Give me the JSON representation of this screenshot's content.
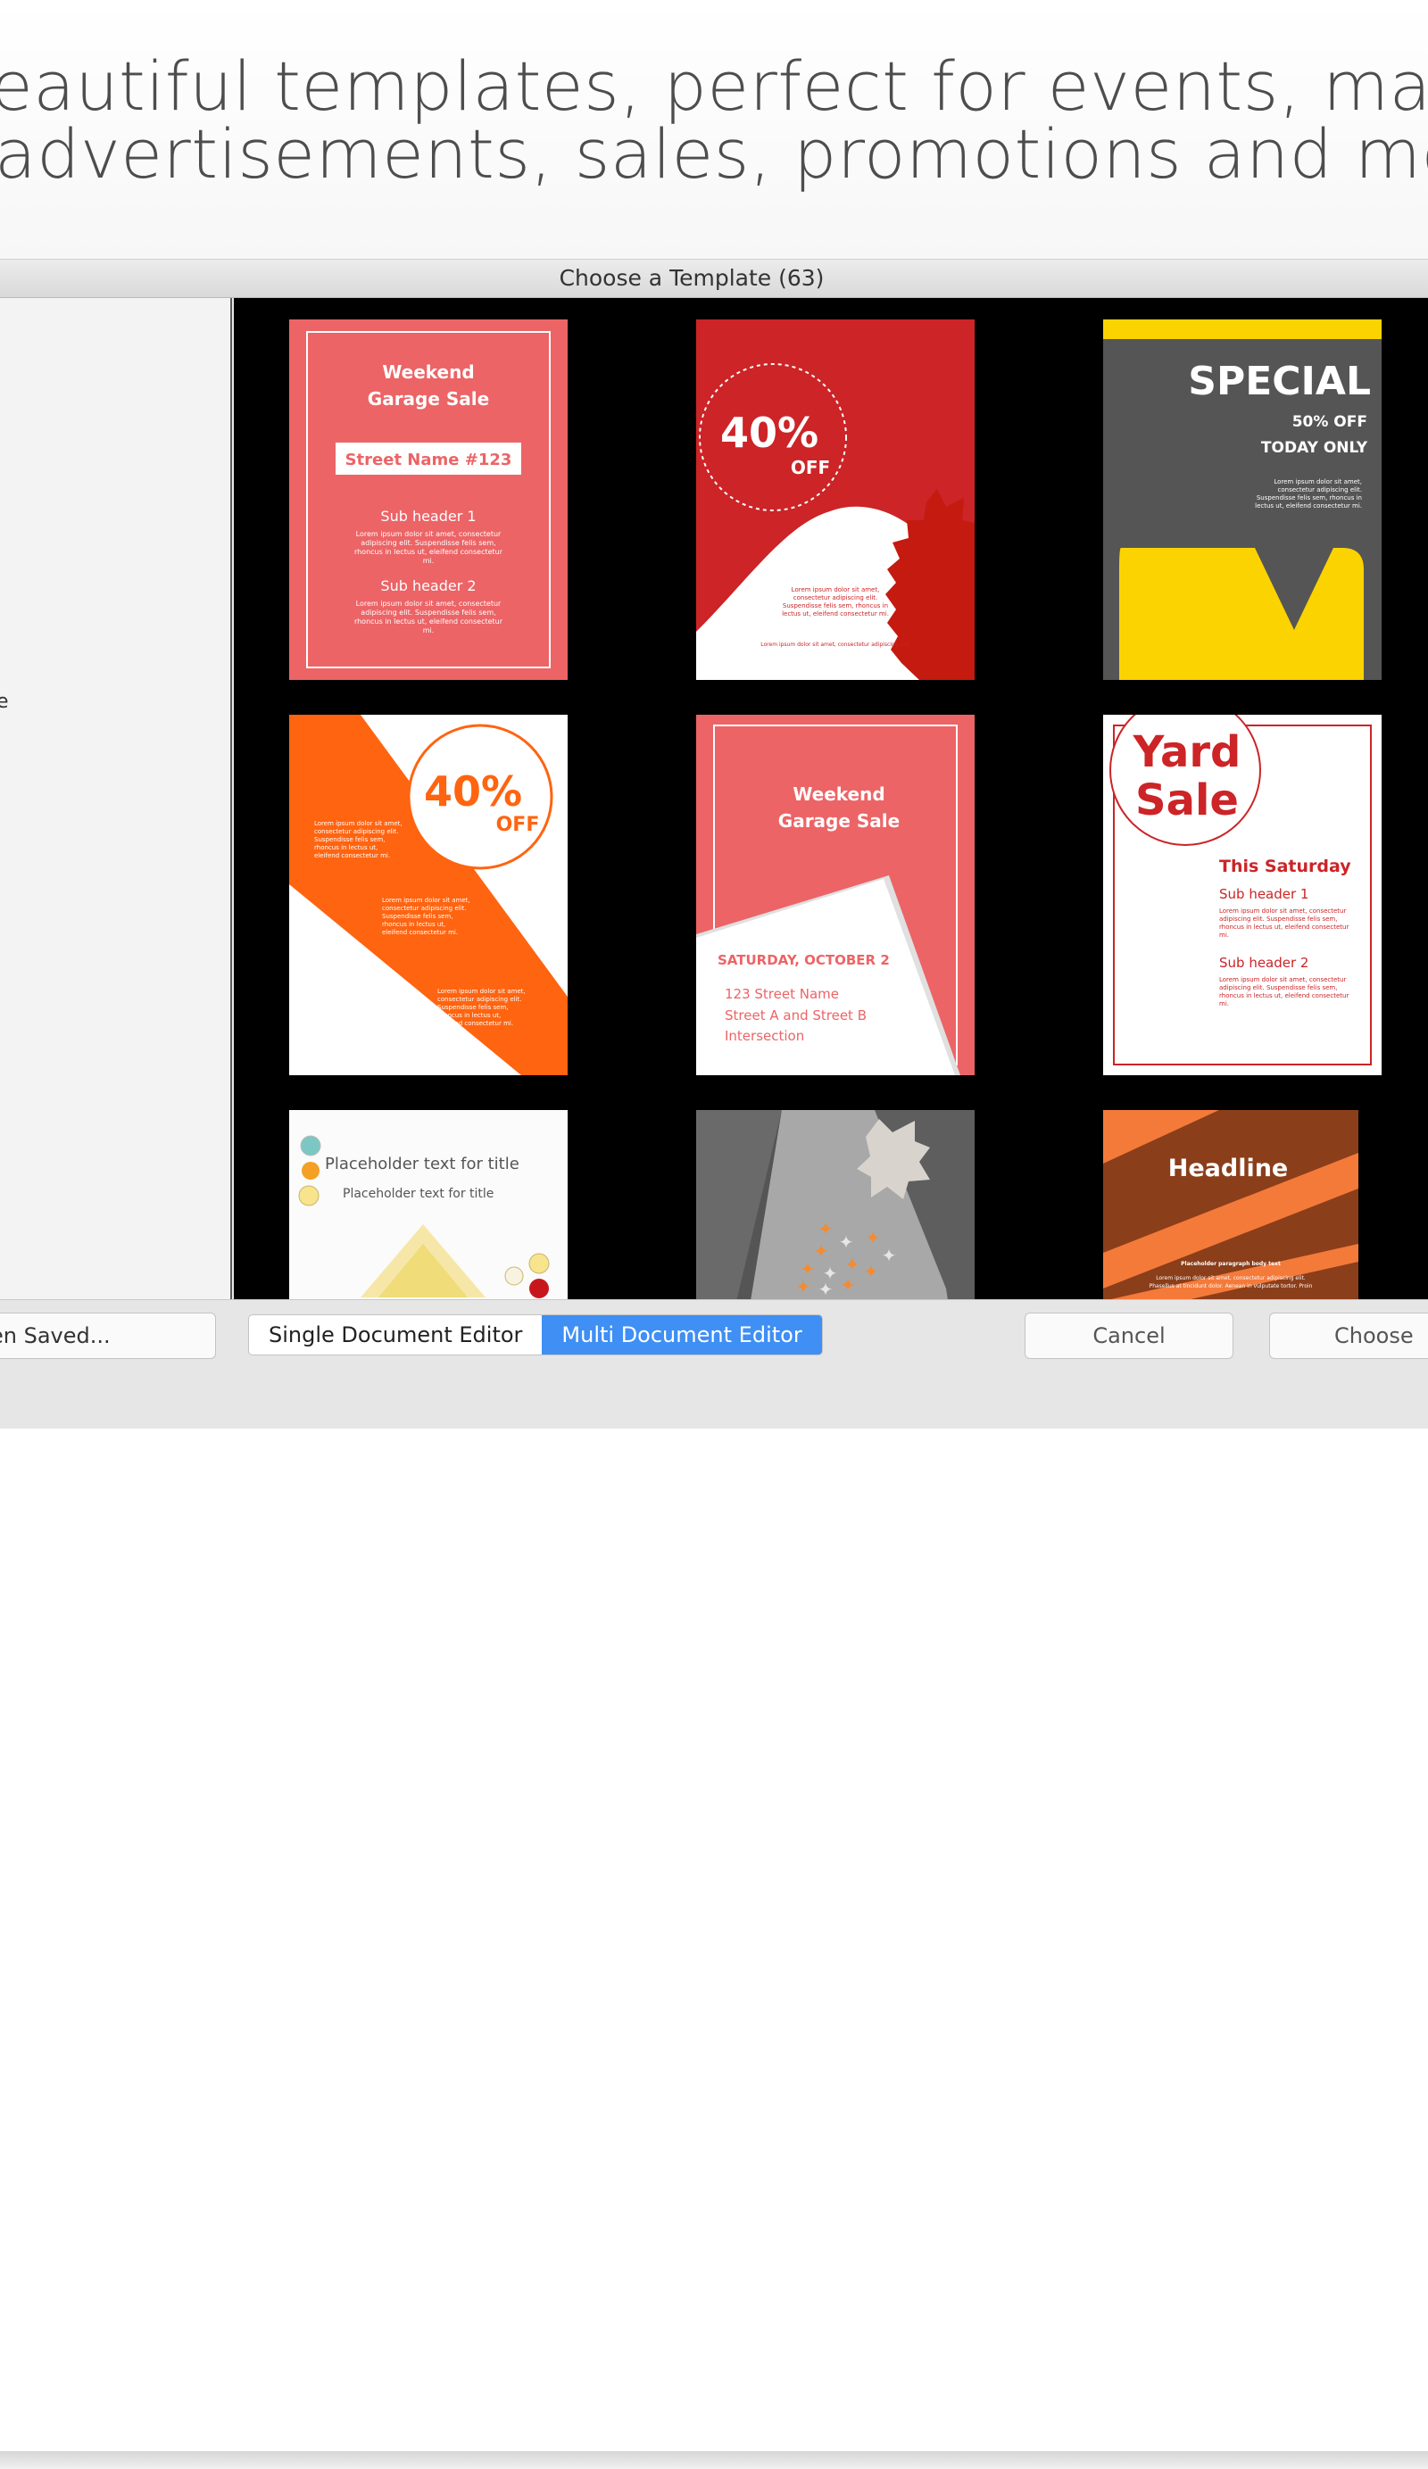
{
  "promo": {
    "line1": "eautiful templates, perfect for events, market",
    "line2": "advertisements, sales, promotions and more!"
  },
  "window": {
    "title": "Choose a Template (63)"
  },
  "sidebar": {
    "stray": "e"
  },
  "templates": {
    "t1": {
      "title1": "Weekend",
      "title2": "Garage Sale",
      "street": "Street Name #123",
      "sub1": "Sub header 1",
      "sub2": "Sub header 2",
      "body1": "Lorem ipsum dolor sit amet, consectetur",
      "body2": "adipiscing elit. Suspendisse felis sem,",
      "body3": "rhoncus in lectus ut, eleifend consectetur",
      "body4": "mi."
    },
    "t2": {
      "pct": "40%",
      "off": "OFF",
      "body1": "Lorem ipsum dolor sit amet,",
      "body2": "consectetur adipiscing elit.",
      "body3": "Suspendisse felis sem, rhoncus in",
      "body4": "lectus ut, eleifend consectetur mi.",
      "foot": "Lorem ipsum dolor sit amet, consectetur adipiscing elit."
    },
    "t3": {
      "special": "SPECIAL",
      "line1": "50% OFF",
      "line2": "TODAY ONLY",
      "body1": "Lorem ipsum dolor sit amet,",
      "body2": "consectetur adipiscing elit.",
      "body3": "Suspendisse felis sem, rhoncus in",
      "body4": "lectus ut, eleifend consectetur mi."
    },
    "t4": {
      "pct": "40%",
      "off": "OFF",
      "a1": "Lorem ipsum dolor sit amet,",
      "a2": "consectetur adipiscing elit.",
      "a3": "Suspendisse felis sem,",
      "a4": "rhoncus in lectus ut,",
      "a5": "eleifend consectetur mi."
    },
    "t5": {
      "title1": "Weekend",
      "title2": "Garage Sale",
      "date": "SATURDAY, OCTOBER 2",
      "addr1": "123 Street Name",
      "addr2": "Street A and Street B",
      "addr3": "Intersection"
    },
    "t6": {
      "yard": "Yard",
      "sale": "Sale",
      "day": "This Saturday",
      "sub1": "Sub header 1",
      "sub2": "Sub header 2",
      "body1": "Lorem ipsum dolor sit amet, consectetur",
      "body2": "adipiscing elit. Suspendisse felis sem,",
      "body3": "rhoncus in lectus ut, eleifend consectetur",
      "body4": "mi."
    },
    "t7": {
      "title": "Placeholder text for title",
      "subtitle": "Placeholder text for title"
    },
    "t9": {
      "headline": "Headline",
      "body_title": "Placeholder paragraph body text",
      "body1": "Lorem ipsum dolor sit amet, consectetur adipiscing elit.",
      "body2": "Phasellus at tincidunt dolor. Aenean in vulputate tortor. Proin"
    }
  },
  "footer": {
    "open_saved": "en Saved...",
    "single_editor": "Single Document Editor",
    "multi_editor": "Multi Document Editor",
    "cancel": "Cancel",
    "choose": "Choose"
  },
  "colors": {
    "accent": "#3f8ff4",
    "coral": "#ec6466",
    "red": "#cc2427",
    "orange": "#ff6410",
    "yellow": "#fbd300",
    "dark_gray": "#555555"
  }
}
